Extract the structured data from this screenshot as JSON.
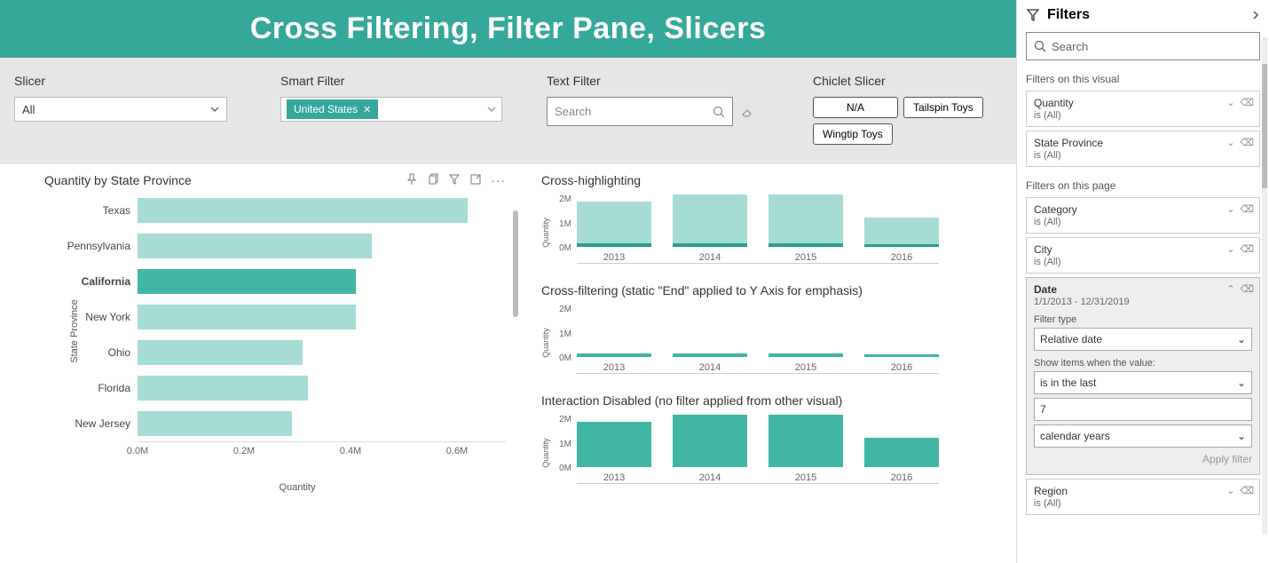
{
  "header": {
    "title": "Cross Filtering, Filter Pane, Slicers"
  },
  "controls": {
    "slicer": {
      "label": "Slicer",
      "value": "All"
    },
    "smart": {
      "label": "Smart Filter",
      "tag": "United States"
    },
    "text": {
      "label": "Text Filter",
      "placeholder": "Search"
    },
    "chiclet": {
      "label": "Chiclet Slicer",
      "items": [
        "N/A",
        "Tailspin Toys",
        "Wingtip Toys"
      ]
    }
  },
  "main_chart": {
    "title": "Quantity by State Province",
    "xlabel": "Quantity",
    "ylabel": "State Province",
    "ticks": [
      "0.0M",
      "0.2M",
      "0.4M",
      "0.6M"
    ]
  },
  "mini": {
    "t1": "Cross-highlighting",
    "t2": "Cross-filtering (static \"End\" applied to Y Axis for emphasis)",
    "t3": "Interaction Disabled (no filter applied from other visual)",
    "yticks": [
      "2M",
      "1M",
      "0M"
    ],
    "ylabel": "Quantity"
  },
  "filters": {
    "title": "Filters",
    "search": "Search",
    "sec_visual": "Filters on this visual",
    "sec_page": "Filters on this page",
    "visual": [
      {
        "name": "Quantity",
        "sub": "is (All)"
      },
      {
        "name": "State Province",
        "sub": "is (All)"
      }
    ],
    "page": [
      {
        "name": "Category",
        "sub": "is (All)"
      },
      {
        "name": "City",
        "sub": "is (All)"
      }
    ],
    "date": {
      "name": "Date",
      "sub": "1/1/2013 - 12/31/2019",
      "ft_label": "Filter type",
      "ft_value": "Relative date",
      "show_label": "Show items when the value:",
      "rel": "is in the last",
      "num": "7",
      "unit": "calendar years",
      "apply": "Apply filter"
    },
    "region": {
      "name": "Region",
      "sub": "is (All)"
    }
  },
  "chart_data": [
    {
      "type": "bar",
      "orientation": "horizontal",
      "title": "Quantity by State Province",
      "xlabel": "Quantity",
      "ylabel": "State Province",
      "xlim": [
        0,
        0.65
      ],
      "xunit": "M",
      "categories": [
        "Texas",
        "Pennsylvania",
        "California",
        "New York",
        "Ohio",
        "Florida",
        "New Jersey"
      ],
      "values": [
        0.62,
        0.44,
        0.41,
        0.41,
        0.31,
        0.32,
        0.29
      ],
      "highlighted": "California"
    },
    {
      "type": "bar",
      "title": "Cross-highlighting",
      "ylabel": "Quantity",
      "ylim": [
        0,
        2.5
      ],
      "yunit": "M",
      "categories": [
        "2013",
        "2014",
        "2015",
        "2016"
      ],
      "series": [
        {
          "name": "total",
          "values": [
            2.0,
            2.3,
            2.3,
            1.3
          ]
        },
        {
          "name": "highlighted",
          "values": [
            0.15,
            0.17,
            0.17,
            0.1
          ]
        }
      ]
    },
    {
      "type": "bar",
      "title": "Cross-filtering (static \"End\" applied to Y Axis for emphasis)",
      "ylabel": "Quantity",
      "ylim": [
        0,
        2.5
      ],
      "yunit": "M",
      "categories": [
        "2013",
        "2014",
        "2015",
        "2016"
      ],
      "values": [
        0.15,
        0.17,
        0.17,
        0.1
      ]
    },
    {
      "type": "bar",
      "title": "Interaction Disabled (no filter applied from other visual)",
      "ylabel": "Quantity",
      "ylim": [
        0,
        2.5
      ],
      "yunit": "M",
      "categories": [
        "2013",
        "2014",
        "2015",
        "2016"
      ],
      "values": [
        2.0,
        2.3,
        2.3,
        1.3
      ]
    }
  ]
}
